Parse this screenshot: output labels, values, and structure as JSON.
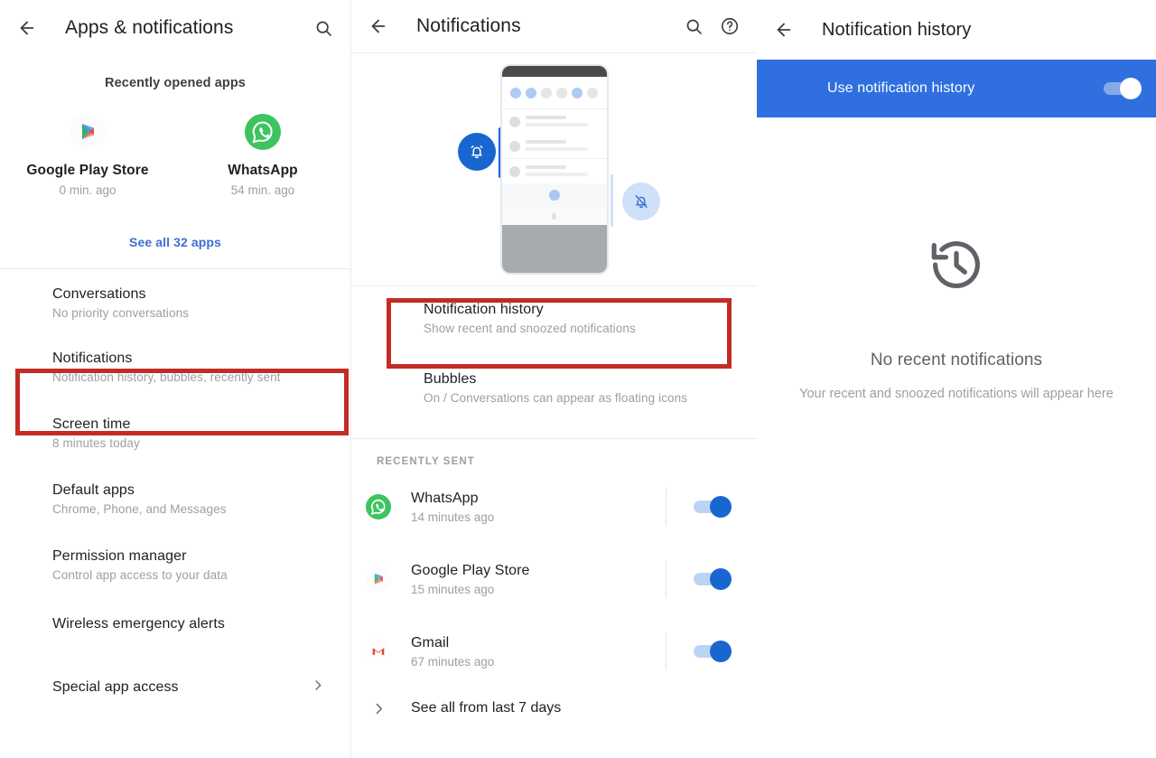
{
  "left": {
    "appbar": {
      "back_icon": "arrow-back-icon",
      "title": "Apps & notifications",
      "search_icon": "search-icon"
    },
    "recent_header": "Recently opened apps",
    "recent_apps": [
      {
        "name": "Google Play Store",
        "time": "0 min. ago",
        "icon": "google-play-icon"
      },
      {
        "name": "WhatsApp",
        "time": "54 min. ago",
        "icon": "whatsapp-icon"
      }
    ],
    "see_all": "See all 32 apps",
    "items": [
      {
        "title": "Conversations",
        "subtitle": "No priority conversations"
      },
      {
        "title": "Notifications",
        "subtitle": "Notification history, bubbles, recently sent"
      },
      {
        "title": "Screen time",
        "subtitle": "8 minutes today"
      },
      {
        "title": "Default apps",
        "subtitle": "Chrome, Phone, and Messages"
      },
      {
        "title": "Permission manager",
        "subtitle": "Control app access to your data"
      },
      {
        "title": "Wireless emergency alerts",
        "subtitle": ""
      },
      {
        "title": "Special app access",
        "subtitle": ""
      }
    ]
  },
  "middle": {
    "appbar": {
      "back_icon": "arrow-back-icon",
      "title": "Notifications",
      "search_icon": "search-icon",
      "help_icon": "help-circle-icon"
    },
    "illustration": {
      "bell_on_icon": "bell-ringing-icon",
      "bell_off_icon": "bell-off-icon"
    },
    "items": [
      {
        "title": "Notification history",
        "subtitle": "Show recent and snoozed notifications"
      },
      {
        "title": "Bubbles",
        "subtitle": "On / Conversations can appear as floating icons"
      }
    ],
    "recently_sent_label": "Recently sent",
    "apps": [
      {
        "name": "WhatsApp",
        "time": "14 minutes ago",
        "icon": "whatsapp-icon",
        "toggle": "on"
      },
      {
        "name": "Google Play Store",
        "time": "15 minutes ago",
        "icon": "google-play-icon",
        "toggle": "on"
      },
      {
        "name": "Gmail",
        "time": "67 minutes ago",
        "icon": "gmail-icon",
        "toggle": "on"
      }
    ],
    "see_all_row": {
      "label": "See all from last 7 days",
      "icon": "chevron-right-icon"
    }
  },
  "right": {
    "appbar": {
      "back_icon": "arrow-back-icon",
      "title": "Notification history"
    },
    "banner": {
      "label": "Use notification history",
      "toggle": "on"
    },
    "empty_state": {
      "icon": "history-clock-icon",
      "title": "No recent notifications",
      "subtitle": "Your recent and snoozed notifications will appear here"
    }
  },
  "highlights": {
    "color": "#c42b26",
    "targets": [
      "left-notifications-row",
      "middle-notification-history-row"
    ]
  },
  "colors": {
    "accent_blue": "#2f6fe0",
    "toggle_blue": "#1a66d0",
    "link_blue": "#3d6fd0",
    "highlight_red": "#c42b26"
  }
}
